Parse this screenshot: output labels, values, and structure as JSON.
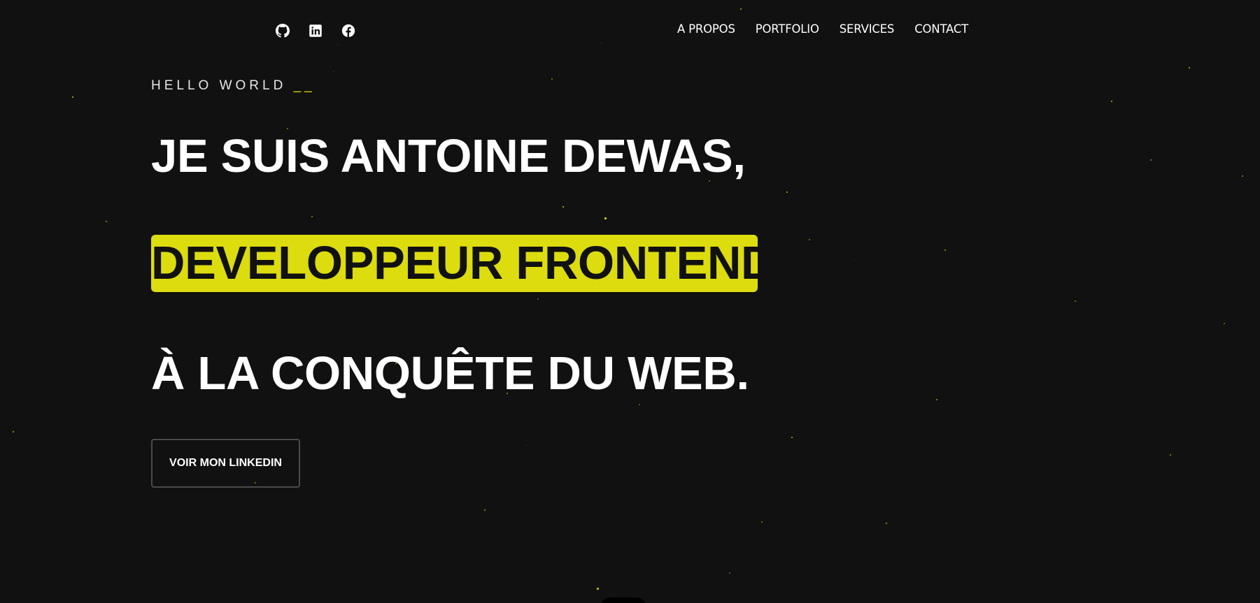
{
  "colors": {
    "background": "#111111",
    "accent": "#dcdc0e",
    "text": "#ffffff"
  },
  "social": [
    {
      "icon": "github-icon"
    },
    {
      "icon": "linkedin-icon"
    },
    {
      "icon": "facebook-icon"
    }
  ],
  "nav": {
    "items": [
      "A PROPOS",
      "PORTFOLIO",
      "SERVICES",
      "CONTACT"
    ]
  },
  "hero": {
    "tagline": "HELLO WORLD",
    "tagline_cursor": "__",
    "line1": "JE SUIS ANTOINE DEWAS,",
    "highlight": "DEVELOPPEUR FRONTEND",
    "line3": "À LA CONQUÊTE DU WEB.",
    "cta_label": "VOIR MON LINKEDIN"
  }
}
